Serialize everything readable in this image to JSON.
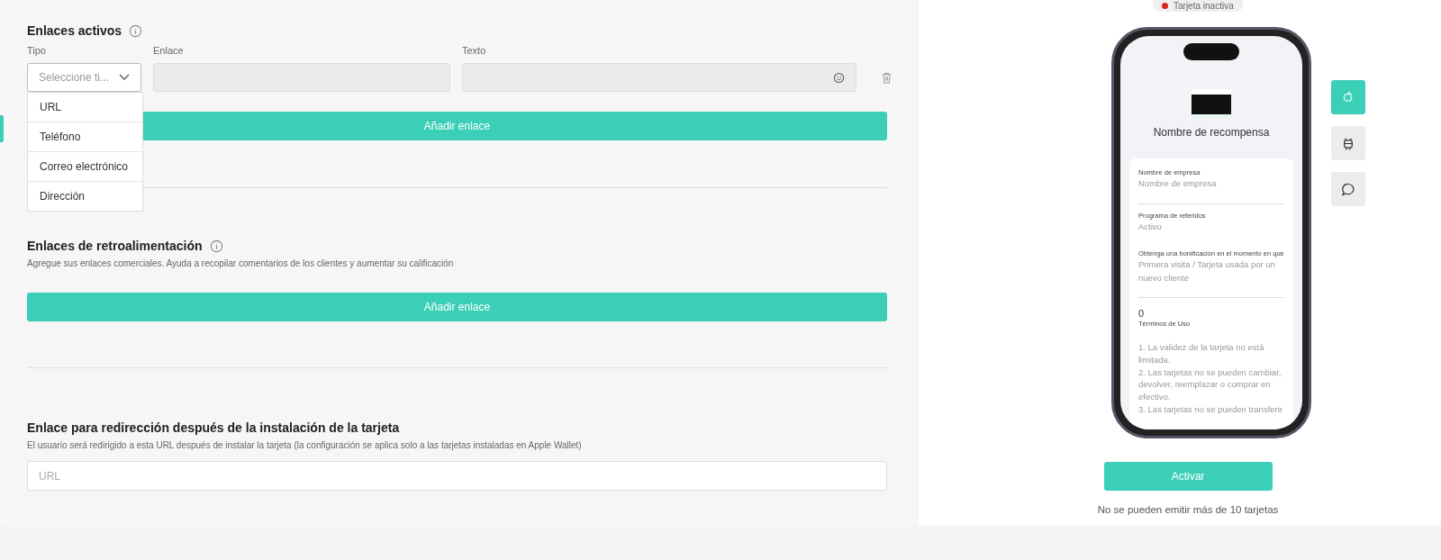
{
  "active_links": {
    "title": "Enlaces activos",
    "columns": [
      "Tipo",
      "Enlace",
      "Texto"
    ],
    "type_select": {
      "placeholder": "Seleccione ti...",
      "expanded": true,
      "options": [
        "URL",
        "Teléfono",
        "Correo electrónico",
        "Dirección"
      ]
    },
    "add_button": "Añadir enlace"
  },
  "feedback_links": {
    "title": "Enlaces de retroalimentación",
    "description": "Agregue sus enlaces comerciales. Ayuda a recopilar comentarios de los clientes y aumentar su calificación",
    "add_button": "Añadir enlace"
  },
  "redirect": {
    "title": "Enlace para redirección después de la instalación de la tarjeta",
    "description": "El usuario será redirigido a esta URL después de instalar la tarjeta (la configuración se aplica solo a las tarjetas instaladas en Apple Wallet)",
    "placeholder": "URL"
  },
  "preview": {
    "status": {
      "label": "Tarjeta inactiva",
      "color": "#e02424"
    },
    "reward_name": "Nombre de recompensa",
    "fields": [
      {
        "label": "Nombre de empresa",
        "value": "Nombre de empresa",
        "divider": true
      },
      {
        "label": "Programa de referidos",
        "value": "Activo",
        "divider": false
      },
      {
        "label": "Obtenga una bonificación en el momento en que",
        "value": "Primera visita / Tarjeta usada por un nuevo cliente",
        "divider": true
      }
    ],
    "count": "0",
    "terms_label": "Términos de Uso",
    "terms": "1. La validez de la tarjeta no está limitada.\n2. Las tarjetas no se pueden cambiar, devolver, reemplazar o comprar en efectivo.\n3. Las tarjetas no se pueden transferir",
    "platforms": [
      {
        "kind": "apple",
        "selected": true
      },
      {
        "kind": "android",
        "selected": false
      },
      {
        "kind": "chat",
        "selected": false
      }
    ],
    "activate_button": "Activar",
    "note": "No se pueden emitir más de 10 tarjetas"
  }
}
